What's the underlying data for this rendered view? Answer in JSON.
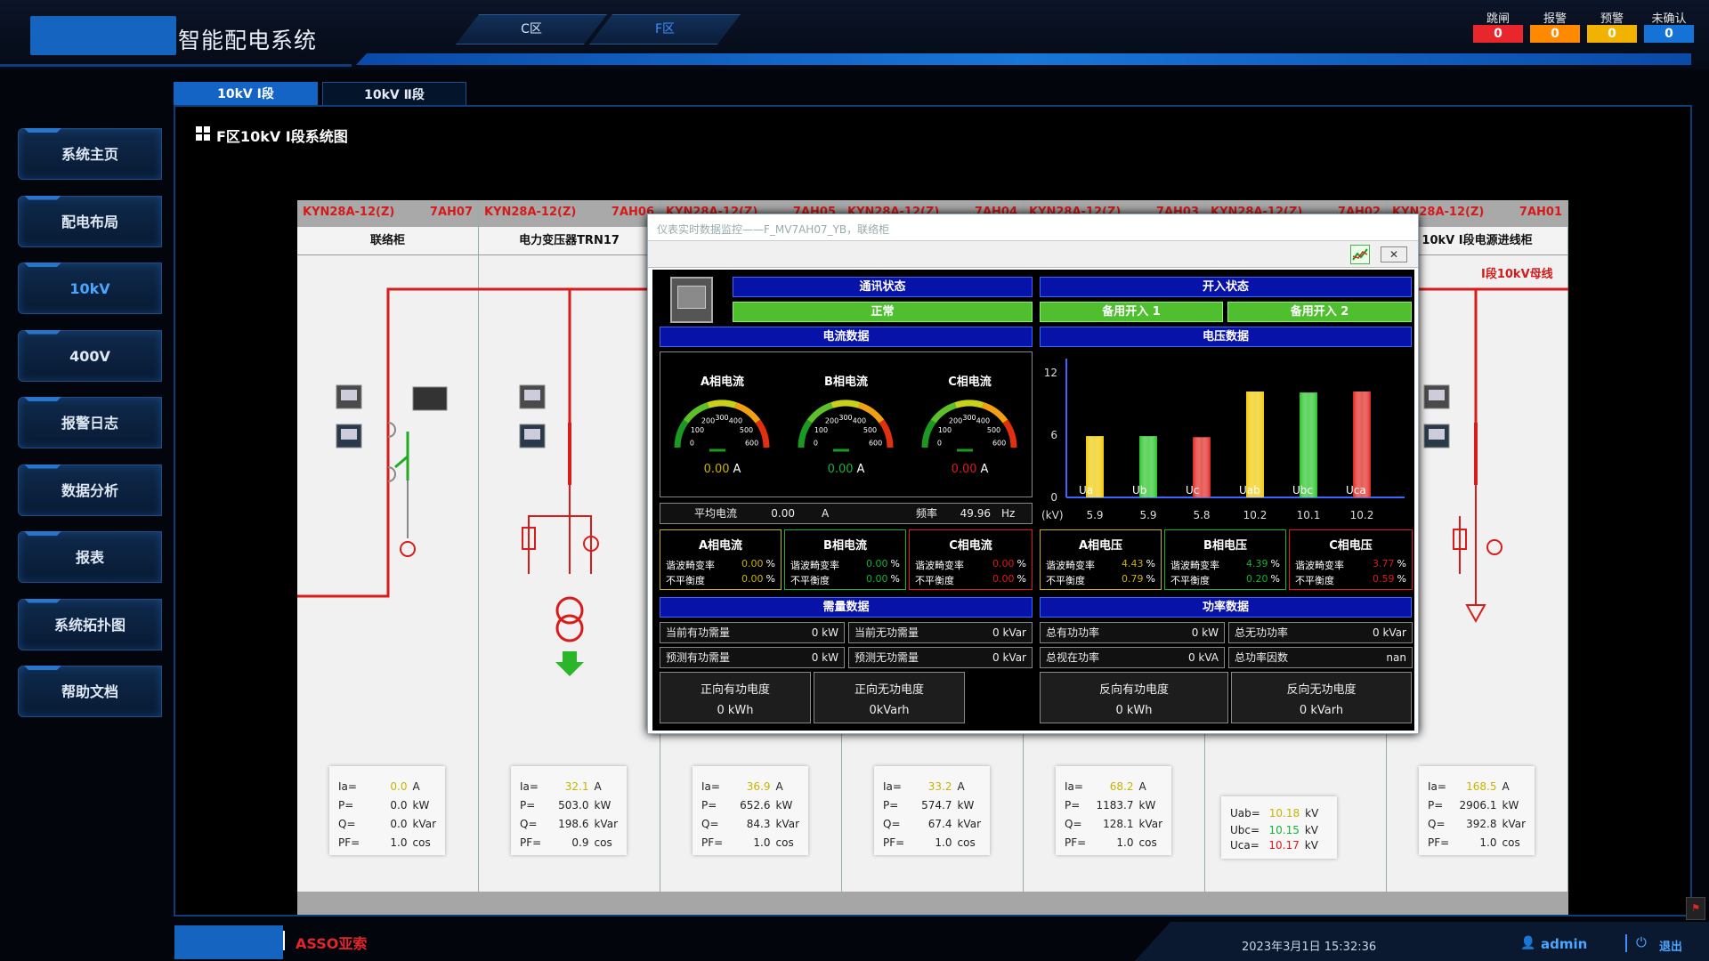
{
  "header": {
    "title": "智能配电系统",
    "zone_tabs": [
      "C区",
      "F区"
    ]
  },
  "alarms": [
    {
      "label": "跳闸",
      "value": "0",
      "color": "#e8262b"
    },
    {
      "label": "报警",
      "value": "0",
      "color": "#ff8a00"
    },
    {
      "label": "预警",
      "value": "0",
      "color": "#f2b300"
    },
    {
      "label": "未确认",
      "value": "0",
      "color": "#1573d8"
    }
  ],
  "sidebar": {
    "items": [
      "系统主页",
      "配电布局",
      "10kV",
      "400V",
      "报警日志",
      "数据分析",
      "报表",
      "系统拓扑图",
      "帮助文档"
    ],
    "active": "10kV"
  },
  "tabs": {
    "tab1": "10kV Ⅰ段",
    "tab2": "10kV Ⅱ段"
  },
  "section_title": "F区10kV Ⅰ段系统图",
  "cabinets": [
    {
      "model": "KYN28A-12(Z)",
      "code": "7AH07",
      "name": "联络柜",
      "ia": "0.0",
      "p": "0.0",
      "q": "0.0",
      "pf": "1.0"
    },
    {
      "model": "KYN28A-12(Z)",
      "code": "7AH06",
      "name": "电力变压器TRN17",
      "ia": "32.1",
      "p": "503.0",
      "q": "198.6",
      "pf": "0.9"
    },
    {
      "model": "KYN28A-12(Z)",
      "code": "7AH05",
      "name": "",
      "ia": "36.9",
      "p": "652.6",
      "q": "84.3",
      "pf": "1.0"
    },
    {
      "model": "KYN28A-12(Z)",
      "code": "7AH04",
      "name": "",
      "ia": "33.2",
      "p": "574.7",
      "q": "67.4",
      "pf": "1.0"
    },
    {
      "model": "KYN28A-12(Z)",
      "code": "7AH03",
      "name": "",
      "ia": "68.2",
      "p": "1183.7",
      "q": "128.1",
      "pf": "1.0"
    },
    {
      "model": "KYN28A-12(Z)",
      "code": "7AH02",
      "name": ""
    },
    {
      "model": "KYN28A-12(Z)",
      "code": "7AH01",
      "name": "10kV Ⅰ段电源进线柜",
      "ia": "168.5",
      "p": "2906.1",
      "q": "392.8",
      "pf": "1.0"
    }
  ],
  "meas_labels": {
    "ia": "Ia=",
    "p": "P=",
    "q": "Q=",
    "pf": "PF=",
    "u_a": "A",
    "u_p": "kW",
    "u_q": "kVar",
    "u_pf": "cos",
    "uab": "Uab=",
    "ubc": "Ubc=",
    "uca": "Uca=",
    "u_kv": "kV"
  },
  "voltage_cabinet": {
    "uab": "10.18",
    "ubc": "10.15",
    "uca": "10.17"
  },
  "bus_label": "Ⅰ段10kV母线",
  "dialog": {
    "title": "仪表实时数据监控——F_MV7AH07_YB，联络柜",
    "comm_header": "通讯状态",
    "comm_value": "正常",
    "switch_header": "开入状态",
    "switch1": "备用开入 1",
    "switch2": "备用开入 2",
    "current_header": "电流数据",
    "voltage_header": "电压数据",
    "gauges": [
      {
        "label": "A相电流",
        "value": "0.00",
        "unit": "A",
        "color": "#c8b400"
      },
      {
        "label": "B相电流",
        "value": "0.00",
        "unit": "A",
        "color": "#16b330"
      },
      {
        "label": "C相电流",
        "value": "0.00",
        "unit": "A",
        "color": "#e01a1a"
      }
    ],
    "gauge_ticks": [
      "0",
      "100",
      "200",
      "300",
      "400",
      "500",
      "600"
    ],
    "avg_label": "平均电流",
    "avg_value": "0.00",
    "avg_unit": "A",
    "freq_label": "频率",
    "freq_value": "49.96",
    "freq_unit": "Hz",
    "harmonics": [
      {
        "title": "A相电流",
        "thd": "0.00",
        "unb": "0.00",
        "color": "#c8b400"
      },
      {
        "title": "B相电流",
        "thd": "0.00",
        "unb": "0.00",
        "color": "#16b330"
      },
      {
        "title": "C相电流",
        "thd": "0.00",
        "unb": "0.00",
        "color": "#e01a1a"
      },
      {
        "title": "A相电压",
        "thd": "4.43",
        "unb": "0.79",
        "color": "#c8b400"
      },
      {
        "title": "B相电压",
        "thd": "4.39",
        "unb": "0.20",
        "color": "#16b330"
      },
      {
        "title": "C相电压",
        "thd": "3.77",
        "unb": "0.59",
        "color": "#e01a1a"
      }
    ],
    "thd_label": "谐波畸变率",
    "unb_label": "不平衡度",
    "pct": "%",
    "demand_header": "需量数据",
    "power_header": "功率数据",
    "demand": [
      {
        "label": "当前有功需量",
        "value": "0 kW"
      },
      {
        "label": "当前无功需量",
        "value": "0 kVar"
      },
      {
        "label": "预测有功需量",
        "value": "0 kW"
      },
      {
        "label": "预测无功需量",
        "value": "0 kVar"
      }
    ],
    "power": [
      {
        "label": "总有功功率",
        "value": "0  kW"
      },
      {
        "label": "总无功功率",
        "value": "0 kVar"
      },
      {
        "label": "总视在功率",
        "value": "0 kVA"
      },
      {
        "label": "总功率因数",
        "value": "nan"
      }
    ],
    "energy": [
      {
        "label": "正向有功电度",
        "value": "0 kWh"
      },
      {
        "label": "正向无功电度",
        "value": "0kVarh"
      },
      {
        "label": "反向有功电度",
        "value": "0 kWh"
      },
      {
        "label": "反向无功电度",
        "value": "0 kVarh"
      }
    ]
  },
  "chart_data": {
    "type": "bar",
    "title": "",
    "categories": [
      "Ua",
      "Ub",
      "Uc",
      "Uab",
      "Ubc",
      "Uca"
    ],
    "values": [
      5.9,
      5.9,
      5.8,
      10.2,
      10.1,
      10.2
    ],
    "colors": [
      "#f0c800",
      "#22c322",
      "#e0201a",
      "#f0c800",
      "#22c322",
      "#e0201a"
    ],
    "ylabel": "(kV)",
    "ylim": [
      0,
      12
    ],
    "yticks": [
      0,
      6,
      12
    ]
  },
  "footer": {
    "brand": "ASSO亚索",
    "datetime": "2023年3月1日 15:32:36",
    "user": "admin",
    "logout": "退出"
  }
}
